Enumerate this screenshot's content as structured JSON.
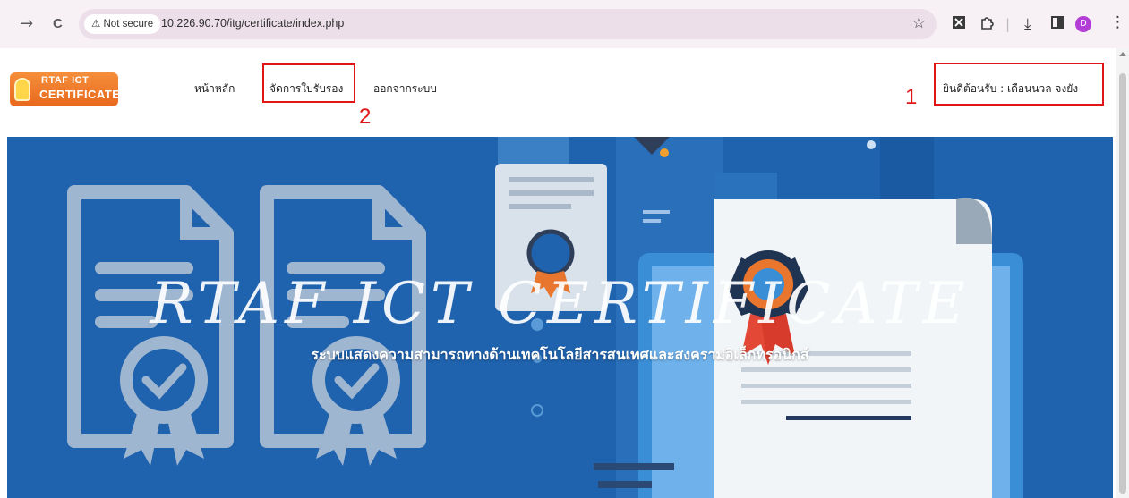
{
  "browser": {
    "forward_icon": "→",
    "reload_icon": "C",
    "security_label": "⚠ Not secure",
    "url": "10.226.90.70/itg/certificate/index.php",
    "bookmark_icon": "☆",
    "download_icon": "⤓",
    "sidebar_icon": "◧",
    "profile_initial": "D",
    "menu_icon": "⋮"
  },
  "site": {
    "logo_line1": "RTAF ICT",
    "logo_line2": "CERTIFICATE",
    "nav": {
      "home": "หน้าหลัก",
      "manage_certificates": "จัดการใบรับรอง",
      "logout": "ออกจากระบบ"
    },
    "welcome": "ยินดีต้อนรับ : เดือนนวล จงยัง"
  },
  "annotations": {
    "marker_1": "1",
    "marker_2": "2",
    "color": "#e01515"
  },
  "hero": {
    "title": "RTAF ICT CERTIFICATE",
    "subtitle": "ระบบแสดงความสามารถทางด้านเทคโนโลยีสารสนเทศและสงครามอิเล็กทรอนิกส์",
    "background_color": "#1f62ad"
  }
}
